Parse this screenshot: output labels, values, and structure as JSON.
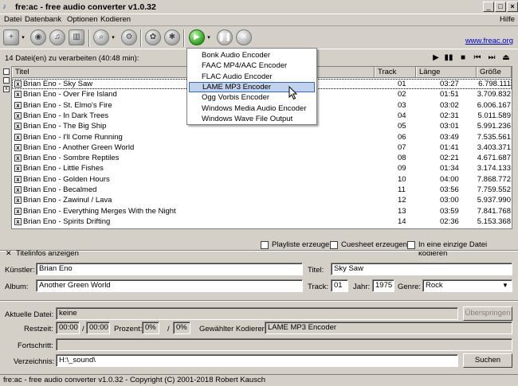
{
  "window": {
    "title": "fre:ac - free audio converter v1.0.32",
    "help": "Hilfe"
  },
  "menu": [
    "Datei",
    "Datenbank",
    "Optionen",
    "Kodieren"
  ],
  "toolbar": {
    "link": "www.freac.org"
  },
  "list": {
    "count_label": "14 Datei(en) zu verarbeiten (40:48 min):",
    "columns": [
      "Titel",
      "Track",
      "Länge",
      "Größe"
    ],
    "rows": [
      {
        "title": "Brian Eno - Sky Saw",
        "track": "01",
        "length": "03:27",
        "size": "6.798.111"
      },
      {
        "title": "Brian Eno - Over Fire Island",
        "track": "02",
        "length": "01:51",
        "size": "3.709.832"
      },
      {
        "title": "Brian Eno - St. Elmo's Fire",
        "track": "03",
        "length": "03:02",
        "size": "6.006.167"
      },
      {
        "title": "Brian Eno - In Dark Trees",
        "track": "04",
        "length": "02:31",
        "size": "5.011.589"
      },
      {
        "title": "Brian Eno - The Big Ship",
        "track": "05",
        "length": "03:01",
        "size": "5.991.236"
      },
      {
        "title": "Brian Eno - I'll Come Running",
        "track": "06",
        "length": "03:49",
        "size": "7.535.561"
      },
      {
        "title": "Brian Eno - Another Green World",
        "track": "07",
        "length": "01:41",
        "size": "3.403.371"
      },
      {
        "title": "Brian Eno - Sombre Reptiles",
        "track": "08",
        "length": "02:21",
        "size": "4.671.687"
      },
      {
        "title": "Brian Eno - Little Fishes",
        "track": "09",
        "length": "01:34",
        "size": "3.174.133"
      },
      {
        "title": "Brian Eno - Golden Hours",
        "track": "10",
        "length": "04:00",
        "size": "7.868.772"
      },
      {
        "title": "Brian Eno - Becalmed",
        "track": "11",
        "length": "03:56",
        "size": "7.759.552"
      },
      {
        "title": "Brian Eno - Zawinul / Lava",
        "track": "12",
        "length": "03:00",
        "size": "5.937.990"
      },
      {
        "title": "Brian Eno - Everything Merges With the Night",
        "track": "13",
        "length": "03:59",
        "size": "7.841.768"
      },
      {
        "title": "Brian Eno - Spirits Drifting",
        "track": "14",
        "length": "02:36",
        "size": "5.153.368"
      }
    ]
  },
  "encoder_menu": {
    "items": [
      "Bonk Audio Encoder",
      "FAAC MP4/AAC Encoder",
      "FLAC Audio Encoder",
      "LAME MP3 Encoder",
      "Ogg Vorbis Encoder",
      "Windows Media Audio Encoder",
      "Windows Wave File Output"
    ],
    "highlighted": "LAME MP3 Encoder"
  },
  "options": {
    "playlist": "Playliste erzeugen",
    "cuesheet": "Cuesheet erzeugen",
    "single_file": "In eine einzige Datei kodieren"
  },
  "titleinfo": {
    "toggle": "Titelinfos anzeigen",
    "artist_label": "Künstler:",
    "artist": "Brian Eno",
    "title_label": "Titel:",
    "title": "Sky Saw",
    "album_label": "Album:",
    "album": "Another Green World",
    "track_label": "Track:",
    "track": "01",
    "year_label": "Jahr:",
    "year": "1975",
    "genre_label": "Genre:",
    "genre": "Rock"
  },
  "progress": {
    "current_label": "Aktuelle Datei:",
    "current": "keine",
    "skip": "Überspringen",
    "time_label": "Restzeit:",
    "time_left": "00:00",
    "time_sep": "/",
    "time_total": "00:00",
    "percent_label": "Prozent:",
    "percent": "0%",
    "percent_sep": "/",
    "percent_total": "0%",
    "encoder_label": "Gewählter Kodierer:",
    "encoder": "LAME MP3 Encoder",
    "progress_label": "Fortschritt:",
    "progress_value": 0,
    "dir_label": "Verzeichnis:",
    "dir": "H:\\_sound\\",
    "browse": "Suchen"
  },
  "status": "fre:ac - free audio converter v1.0.32 - Copyright (C) 2001-2018 Robert Kausch",
  "icons": [
    "app-icon",
    "add-files-icon",
    "cd-icon",
    "cd-info-icon",
    "trash-icon",
    "search-icon",
    "settings-icon",
    "tools-icon",
    "play-icon",
    "pause-icon",
    "stop-icon",
    "close-icon"
  ]
}
